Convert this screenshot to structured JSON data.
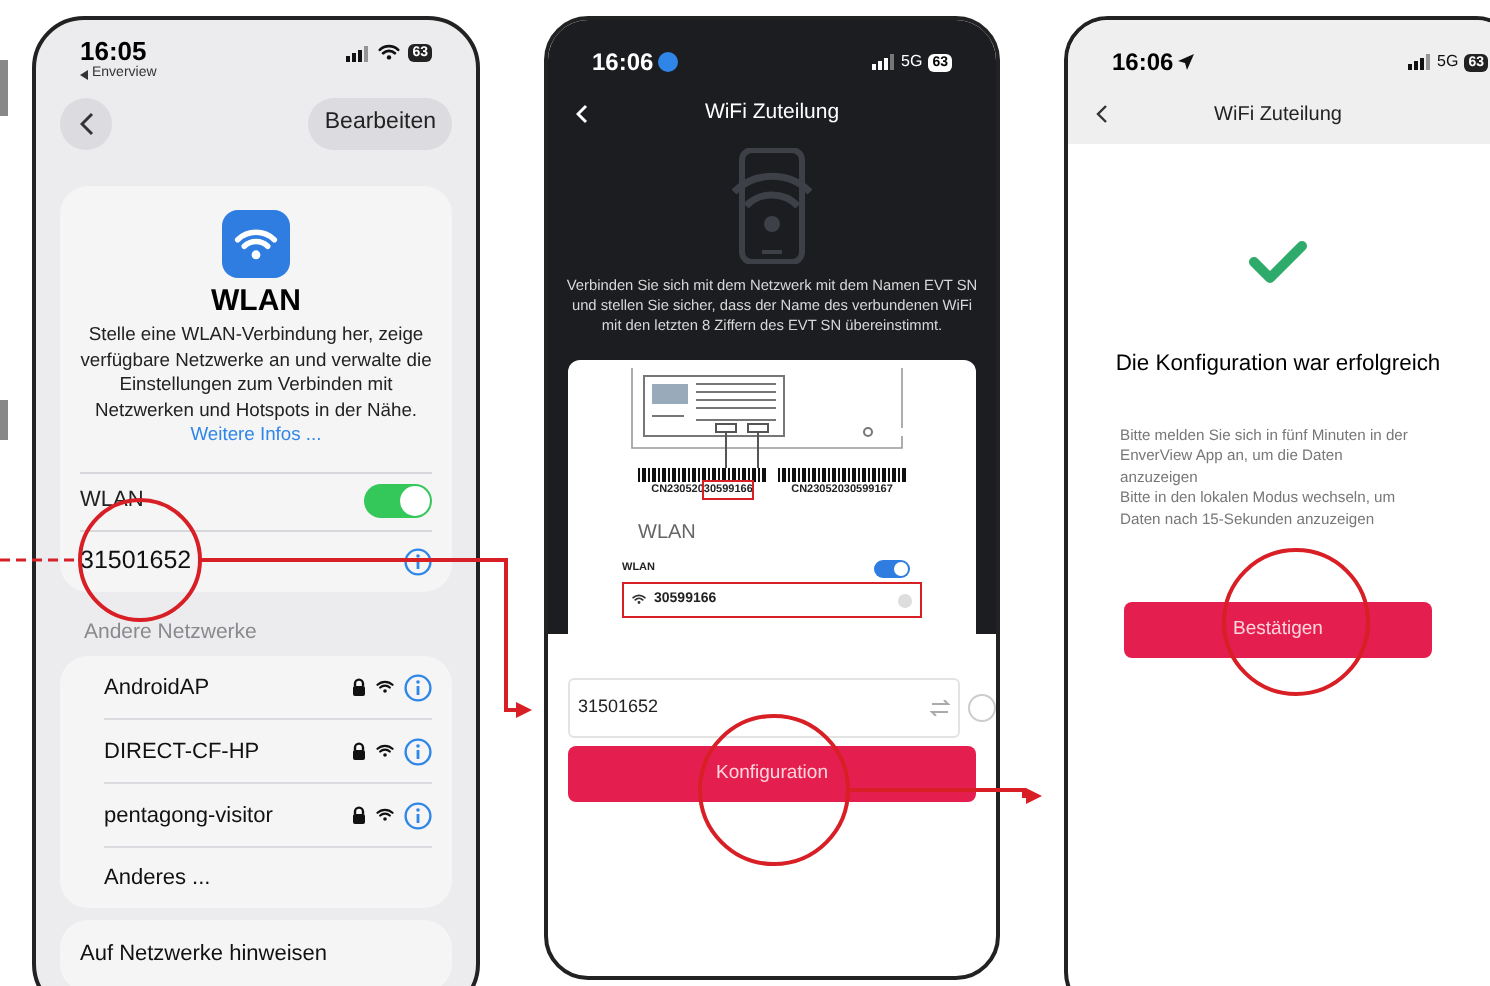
{
  "settings_screen": {
    "time": "16:05",
    "back_app": "Enverview",
    "battery": "63",
    "edit_button": "Bearbeiten",
    "title": "WLAN",
    "description": "Stelle eine WLAN-Verbindung her, zeige verfügbare Netzwerke an und verwalte die Einstellungen zum Verbinden mit Netzwerken und Hotspots in der Nähe.",
    "link": "Weitere Infos ...",
    "wlan_label": "WLAN",
    "wlan_on": true,
    "connected_network": "31501652",
    "section_title": "Andere Netzwerke",
    "networks": [
      {
        "name": "AndroidAP",
        "locked": true
      },
      {
        "name": "DIRECT-CF-HP",
        "locked": true
      },
      {
        "name": "pentagong-visitor",
        "locked": true
      }
    ],
    "other_network": "Anderes ...",
    "footer_item": "Auf Netzwerke hinweisen"
  },
  "config_screen": {
    "time": "16:06",
    "network": "5G",
    "battery": "63",
    "title": "WiFi Zuteilung",
    "instructions": "Verbinden Sie sich mit dem Netzwerk mit dem Namen EVT SN und stellen Sie sicher, dass der Name des verbundenen WiFi mit den letzten 8 Ziffern des EVT SN übereinstimmt.",
    "serials": [
      {
        "text": "CN230520",
        "highlighted_part": "30599166"
      },
      {
        "text": "CN23052030599167"
      }
    ],
    "example_title": "WLAN",
    "example_wlan_label": "WLAN",
    "example_wlan_on": true,
    "example_network": "30599166",
    "wifi_name_value": "31501652",
    "button": "Konfiguration"
  },
  "success_screen": {
    "time": "16:06",
    "network": "5G",
    "battery": "63",
    "title": "WiFi Zuteilung",
    "heading": "Die Konfiguration war erfolgreich",
    "messages": [
      "Bitte melden Sie sich in fünf Minuten in der EnverView App an, um die Daten anzuzeigen",
      "Bitte in den lokalen Modus wechseln, um Daten nach 15-Sekunden anzuzeigen"
    ],
    "button": "Bestätigen"
  }
}
